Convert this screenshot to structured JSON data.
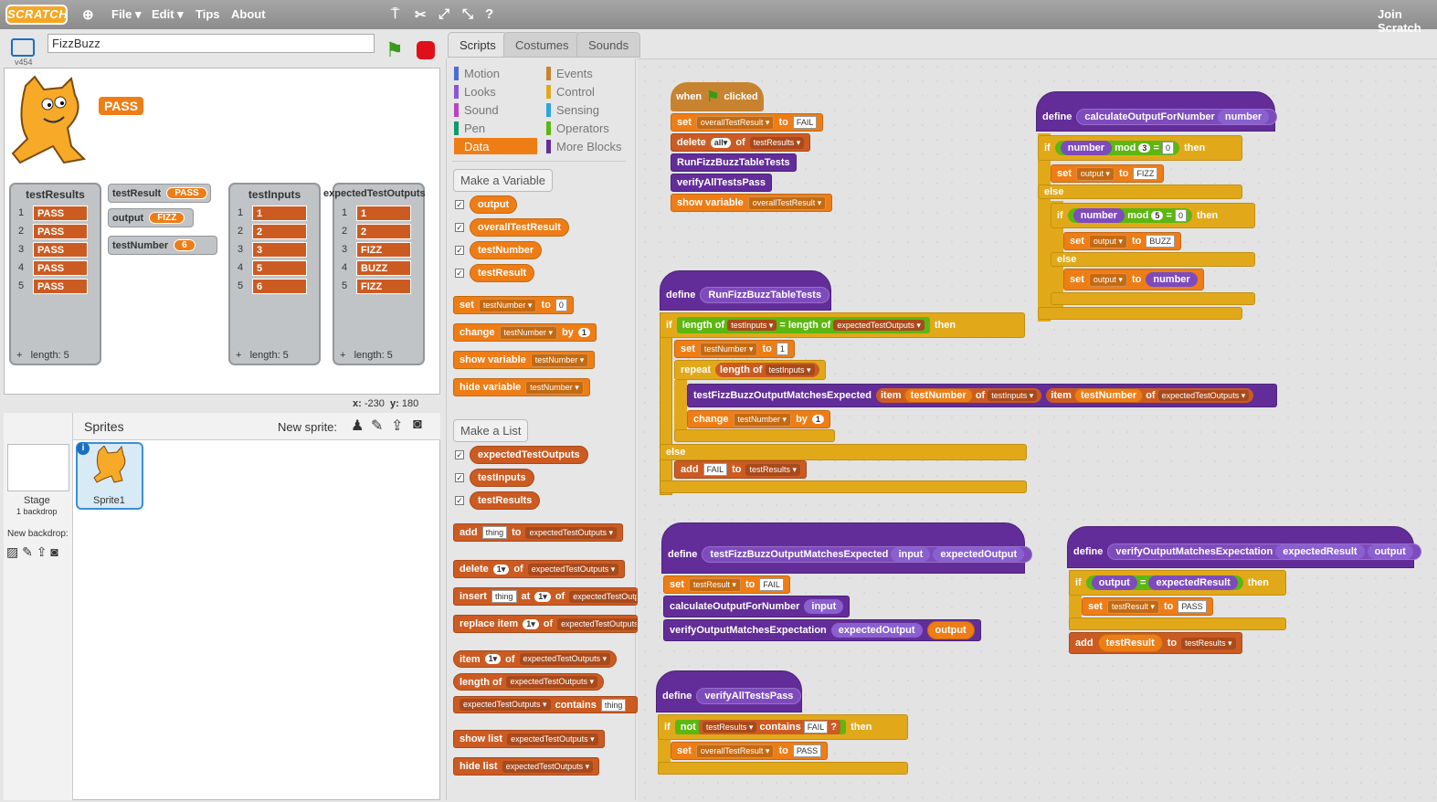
{
  "topbar": {
    "logo": "SCRATCH",
    "menus": [
      "File ▾",
      "Edit ▾",
      "Tips",
      "About"
    ],
    "join": "Join Scratch"
  },
  "stage": {
    "project_name": "FizzBuzz",
    "version": "v454",
    "say": "PASS",
    "coords_x_label": "x:",
    "coords_x": "-230",
    "coords_y_label": "y:",
    "coords_y": "180"
  },
  "monitors": {
    "testResults": {
      "title": "testResults",
      "items": [
        "PASS",
        "PASS",
        "PASS",
        "PASS",
        "PASS"
      ],
      "length": "length: 5"
    },
    "testInputs": {
      "title": "testInputs",
      "items": [
        "1",
        "2",
        "3",
        "5",
        "6"
      ],
      "length": "length: 5"
    },
    "expectedTestOutputs": {
      "title": "expectedTestOutputs",
      "items": [
        "1",
        "2",
        "FIZZ",
        "BUZZ",
        "FIZZ"
      ],
      "length": "length: 5"
    },
    "testResult": {
      "label": "testResult",
      "value": "PASS"
    },
    "output": {
      "label": "output",
      "value": "FIZZ"
    },
    "testNumber": {
      "label": "testNumber",
      "value": "6"
    }
  },
  "sprites": {
    "header": "Sprites",
    "new_sprite": "New sprite:",
    "stage_label": "Stage",
    "stage_sub": "1 backdrop",
    "new_backdrop": "New backdrop:",
    "sprite1": "Sprite1"
  },
  "tabs": [
    "Scripts",
    "Costumes",
    "Sounds"
  ],
  "categories": {
    "left": [
      "Motion",
      "Looks",
      "Sound",
      "Pen",
      "Data"
    ],
    "right": [
      "Events",
      "Control",
      "Sensing",
      "Operators",
      "More Blocks"
    ]
  },
  "palette": {
    "make_variable": "Make a Variable",
    "make_list": "Make a List",
    "variables": [
      "output",
      "overallTestResult",
      "testNumber",
      "testResult"
    ],
    "lists": [
      "expectedTestOutputs",
      "testInputs",
      "testResults"
    ]
  },
  "colors": {
    "data": "#ee7d16",
    "list": "#cc5b22",
    "more": "#632d99",
    "control": "#e1a91a",
    "operators": "#5cb712",
    "events": "#c88330"
  }
}
